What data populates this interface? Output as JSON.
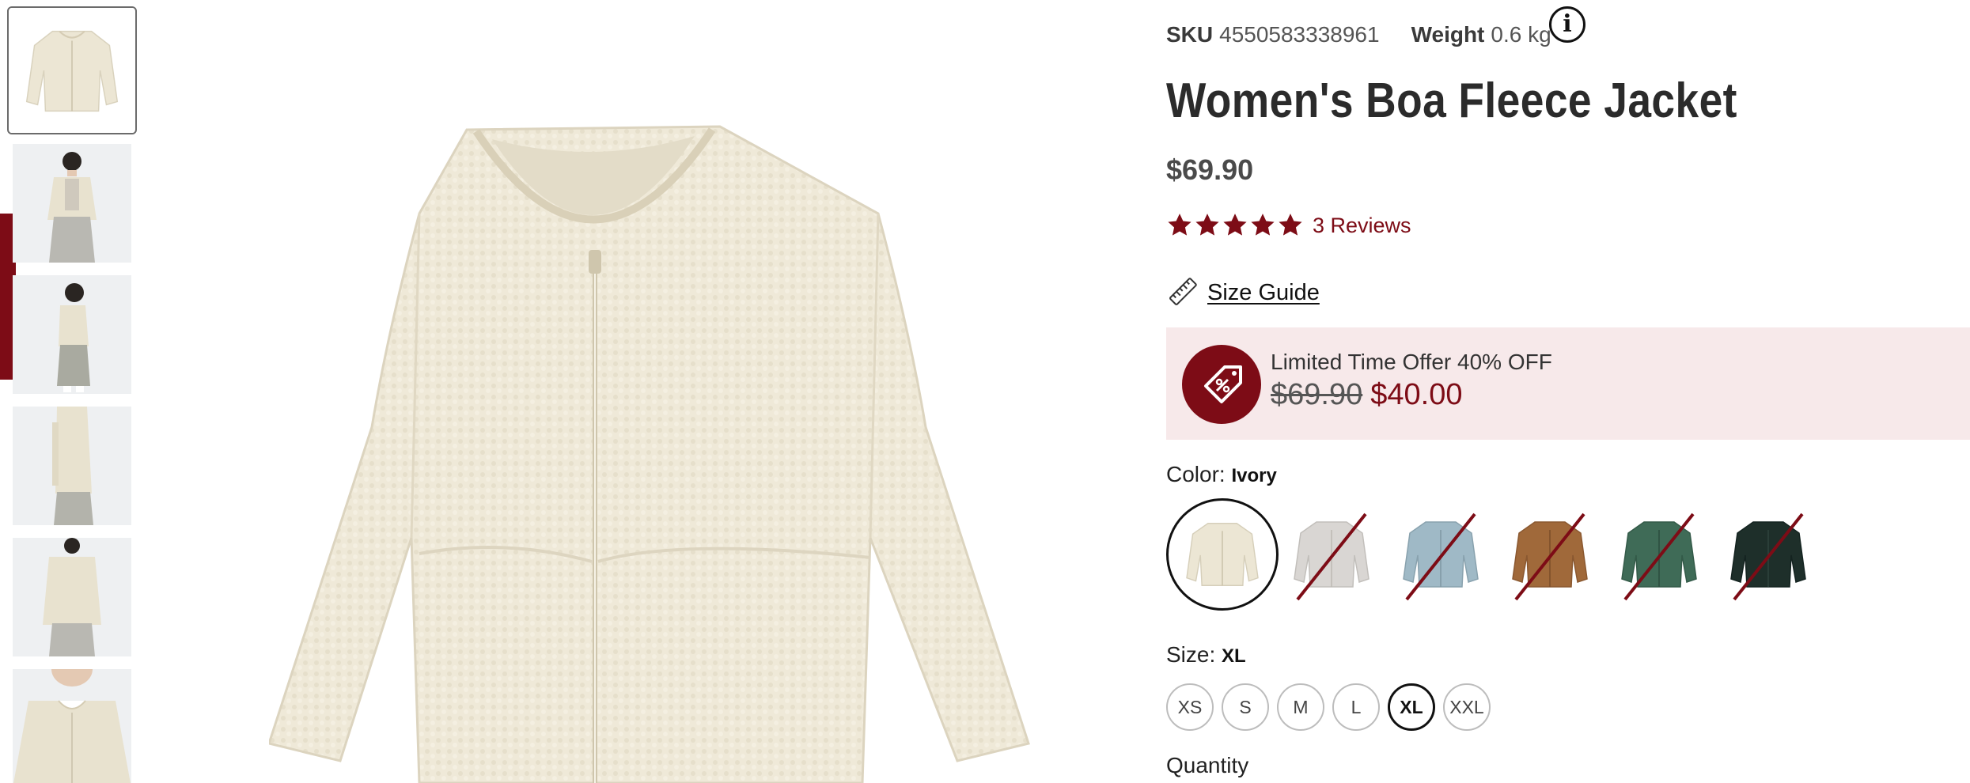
{
  "gallery": {
    "thumbnails": [
      {
        "alt": "jacket-front-thumbnail",
        "view": "front"
      },
      {
        "alt": "model-front-thumbnail",
        "view": "model-front"
      },
      {
        "alt": "model-side-thumbnail",
        "view": "model-side"
      },
      {
        "alt": "model-side-detail-thumbnail",
        "view": "model-side-detail"
      },
      {
        "alt": "model-back-thumbnail",
        "view": "model-back"
      },
      {
        "alt": "model-closeup-thumbnail",
        "view": "model-closeup"
      }
    ],
    "active_index": 0
  },
  "product": {
    "sku_label": "SKU",
    "sku": "4550583338961",
    "weight_label": "Weight",
    "weight": "0.6 kg",
    "title": "Women's Boa Fleece Jacket",
    "price": "$69.90",
    "rating": 5,
    "reviews": "3 Reviews",
    "size_guide": "Size Guide"
  },
  "promo": {
    "title": "Limited Time Offer 40% OFF",
    "old_price": "$69.90",
    "new_price": "$40.00"
  },
  "color": {
    "label": "Color:",
    "selected": "Ivory",
    "swatches": [
      {
        "name": "Ivory",
        "hex": "#ece6d4",
        "available": true,
        "selected": true
      },
      {
        "name": "Light Gray",
        "hex": "#d9d6d3",
        "available": false,
        "selected": false
      },
      {
        "name": "Light Blue",
        "hex": "#9fb9c6",
        "available": false,
        "selected": false
      },
      {
        "name": "Brown",
        "hex": "#a0693a",
        "available": false,
        "selected": false
      },
      {
        "name": "Green",
        "hex": "#3f6b57",
        "available": false,
        "selected": false
      },
      {
        "name": "Dark Green",
        "hex": "#1e2f2a",
        "available": false,
        "selected": false
      }
    ]
  },
  "size": {
    "label": "Size:",
    "selected": "XL",
    "options": [
      "XS",
      "S",
      "M",
      "L",
      "XL",
      "XXL"
    ]
  },
  "quantity": {
    "label": "Quantity"
  },
  "colors": {
    "accent": "#7d0c16",
    "promo_bg": "#f7e9ea",
    "jacket": "#ece6d4"
  },
  "icons": {
    "info": "info-icon",
    "star": "star-icon",
    "ruler": "ruler-icon",
    "discount_tag": "discount-tag-icon"
  }
}
